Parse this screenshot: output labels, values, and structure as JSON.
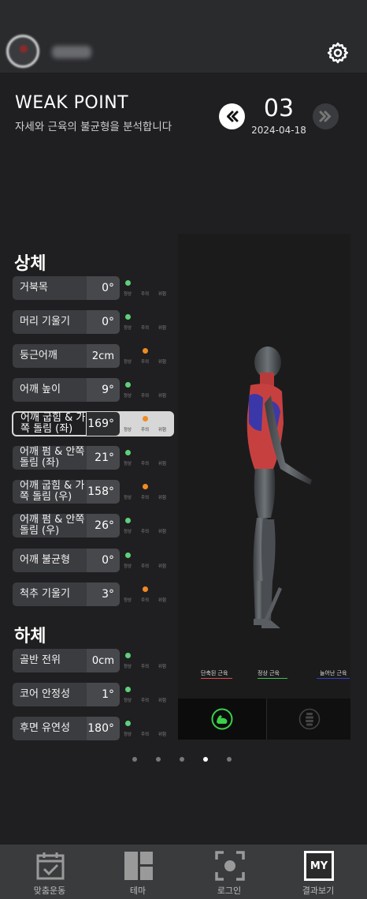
{
  "header": {
    "title": "WEAK POINT",
    "subtitle": "자세와 근육의 불균형을 분석합니다",
    "page_number": "03",
    "date": "2024-04-18"
  },
  "sections": {
    "upper": "상체",
    "lower": "하체"
  },
  "status_labels": {
    "normal": "정상",
    "caution": "주의",
    "danger": "위험"
  },
  "colors": {
    "normal": "#5fd07a",
    "caution": "#f08a24",
    "shortened": "#e04848",
    "normal_muscle": "#3cc24a",
    "lengthened": "#3040c8"
  },
  "metrics_upper": [
    {
      "label": "거북목",
      "value": "0°",
      "status": "normal"
    },
    {
      "label": "머리 기울기",
      "value": "0°",
      "status": "normal"
    },
    {
      "label": "둥근어깨",
      "value": "2cm",
      "status": "caution"
    },
    {
      "label": "어깨 높이",
      "value": "9°",
      "status": "normal"
    },
    {
      "label": "어깨 굽힘 & 가쪽 돌림 (좌)",
      "value": "169°",
      "status": "caution",
      "selected": true
    },
    {
      "label": "어깨 펌 & 안쪽 돌림 (좌)",
      "value": "21°",
      "status": "normal"
    },
    {
      "label": "어깨 굽힘 & 가쪽 돌림 (우)",
      "value": "158°",
      "status": "caution"
    },
    {
      "label": "어깨 펌 & 안쪽 돌림 (우)",
      "value": "26°",
      "status": "normal"
    },
    {
      "label": "어깨 불균형",
      "value": "0°",
      "status": "normal"
    },
    {
      "label": "척추 기울기",
      "value": "3°",
      "status": "caution"
    }
  ],
  "metrics_lower": [
    {
      "label": "골반 전위",
      "value": "0cm",
      "status": "normal"
    },
    {
      "label": "코어 안정성",
      "value": "1°",
      "status": "normal"
    },
    {
      "label": "후면 유연성",
      "value": "180°",
      "status": "normal"
    }
  ],
  "legend": {
    "shortened": "단축된 근육",
    "normal": "정상 근육",
    "lengthened": "늘어난 근육"
  },
  "pager": {
    "count": 5,
    "active": 3
  },
  "nav": [
    {
      "label": "맞춤운동",
      "icon": "calendar-check-icon"
    },
    {
      "label": "테마",
      "icon": "grid-layout-icon"
    },
    {
      "label": "로그인",
      "icon": "scan-frame-icon"
    },
    {
      "label": "결과보기",
      "icon": "my-badge-icon",
      "badge": "MY"
    }
  ]
}
